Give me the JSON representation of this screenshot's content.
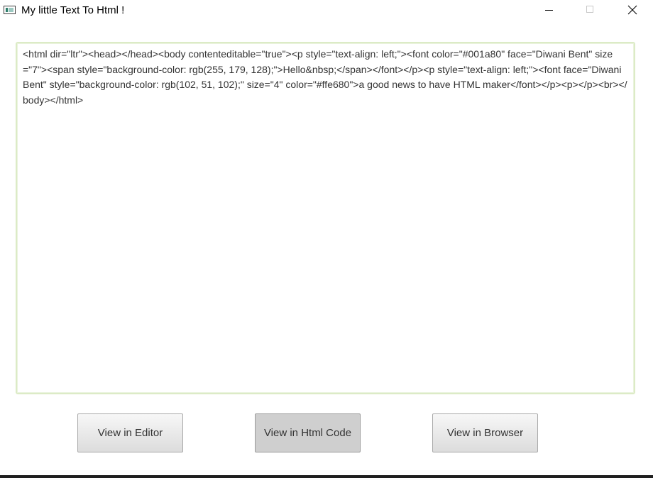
{
  "window": {
    "title": "My little Text To Html !",
    "icon": "app-window-icon"
  },
  "controls": {
    "minimize_icon": "minimize-icon",
    "maximize_icon": "maximize-icon",
    "close_icon": "close-icon"
  },
  "editor": {
    "content": "<html dir=\"ltr\"><head></head><body contenteditable=\"true\"><p style=\"text-align: left;\"><font color=\"#001a80\" face=\"Diwani Bent\" size=\"7\"><span style=\"background-color: rgb(255, 179, 128);\">Hello&nbsp;</span></font></p><p style=\"text-align: left;\"><font face=\"Diwani Bent\" style=\"background-color: rgb(102, 51, 102);\" size=\"4\" color=\"#ffe680\">a good news to have HTML maker</font></p><p></p><br></body></html>"
  },
  "buttons": {
    "editor_label": "View in Editor",
    "html_label": "View in Html Code",
    "browser_label": "View in Browser",
    "selected": "html"
  },
  "colors": {
    "editor_border": "#dcebc6",
    "selected_button": "#cfcfcf",
    "text": "#333333"
  }
}
